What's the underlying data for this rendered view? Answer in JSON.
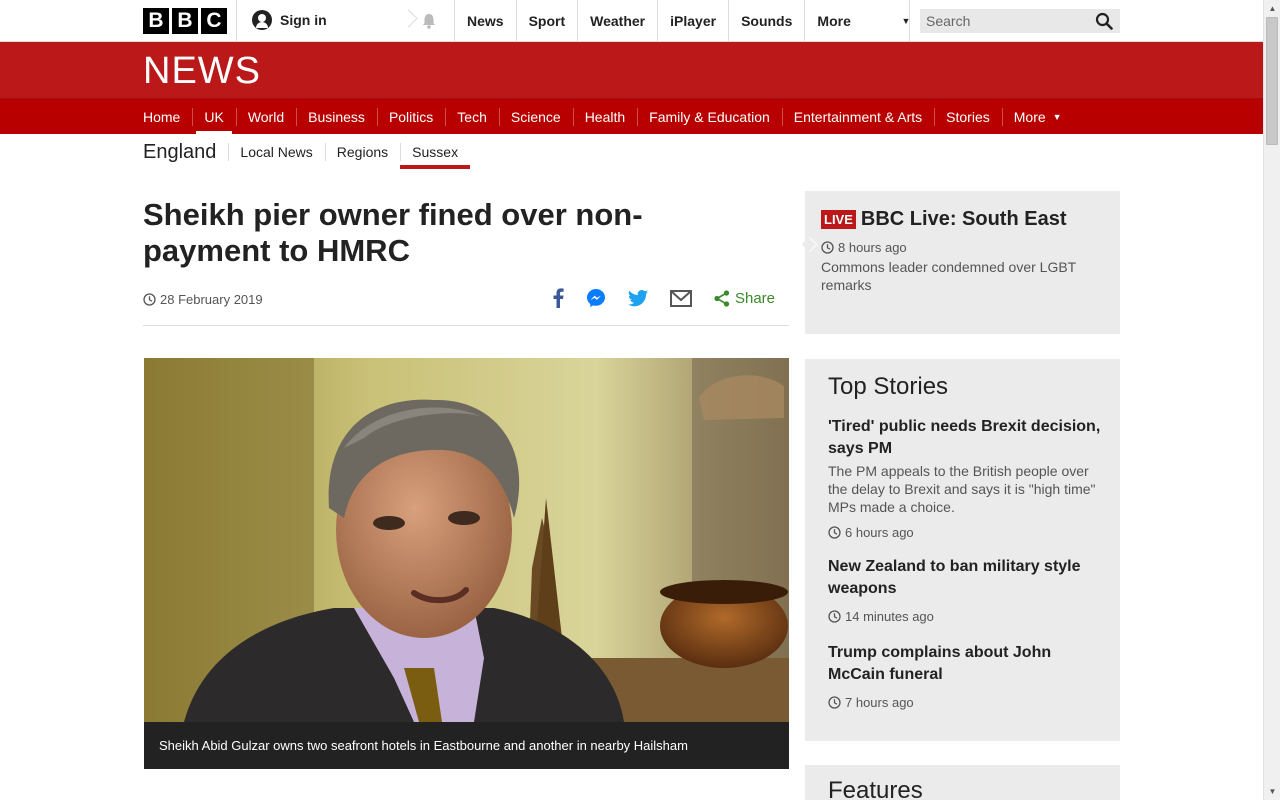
{
  "masthead": {
    "logo_letters": [
      "B",
      "B",
      "C"
    ],
    "signin_label": "Sign in",
    "nav": [
      "News",
      "Sport",
      "Weather",
      "iPlayer",
      "Sounds"
    ],
    "more_label": "More",
    "search_placeholder": "Search"
  },
  "news_banner": {
    "wordmark": "NEWS"
  },
  "section_nav": {
    "items": [
      "Home",
      "UK",
      "World",
      "Business",
      "Politics",
      "Tech",
      "Science",
      "Health",
      "Family & Education",
      "Entertainment & Arts",
      "Stories"
    ],
    "active": "UK",
    "more_label": "More"
  },
  "sub_nav": {
    "region": "England",
    "items": [
      "Local News",
      "Regions",
      "Sussex"
    ],
    "active": "Sussex"
  },
  "article": {
    "headline": "Sheikh pier owner fined over non-payment to HMRC",
    "date": "28 February 2019",
    "share_label": "Share",
    "caption": "Sheikh Abid Gulzar owns two seafront hotels in Eastbourne and another in nearby Hailsham"
  },
  "live": {
    "badge": "LIVE",
    "title": "BBC Live: South East",
    "time": "8 hours ago",
    "summary": "Commons leader condemned over LGBT remarks"
  },
  "top_stories": {
    "heading": "Top Stories",
    "items": [
      {
        "title": "'Tired' public needs Brexit decision, says PM",
        "summary": "The PM appeals to the British people over the delay to Brexit and says it is \"high time\" MPs made a choice.",
        "time": "6 hours ago"
      },
      {
        "title": "New Zealand to ban military style weapons",
        "summary": "",
        "time": "14 minutes ago"
      },
      {
        "title": "Trump complains about John McCain funeral",
        "summary": "",
        "time": "7 hours ago"
      }
    ]
  },
  "features": {
    "heading": "Features"
  },
  "colors": {
    "brand_red": "#bb1919",
    "nav_red": "#b80000",
    "share_green": "#3a8a2a",
    "panel_grey": "#ebebeb"
  }
}
